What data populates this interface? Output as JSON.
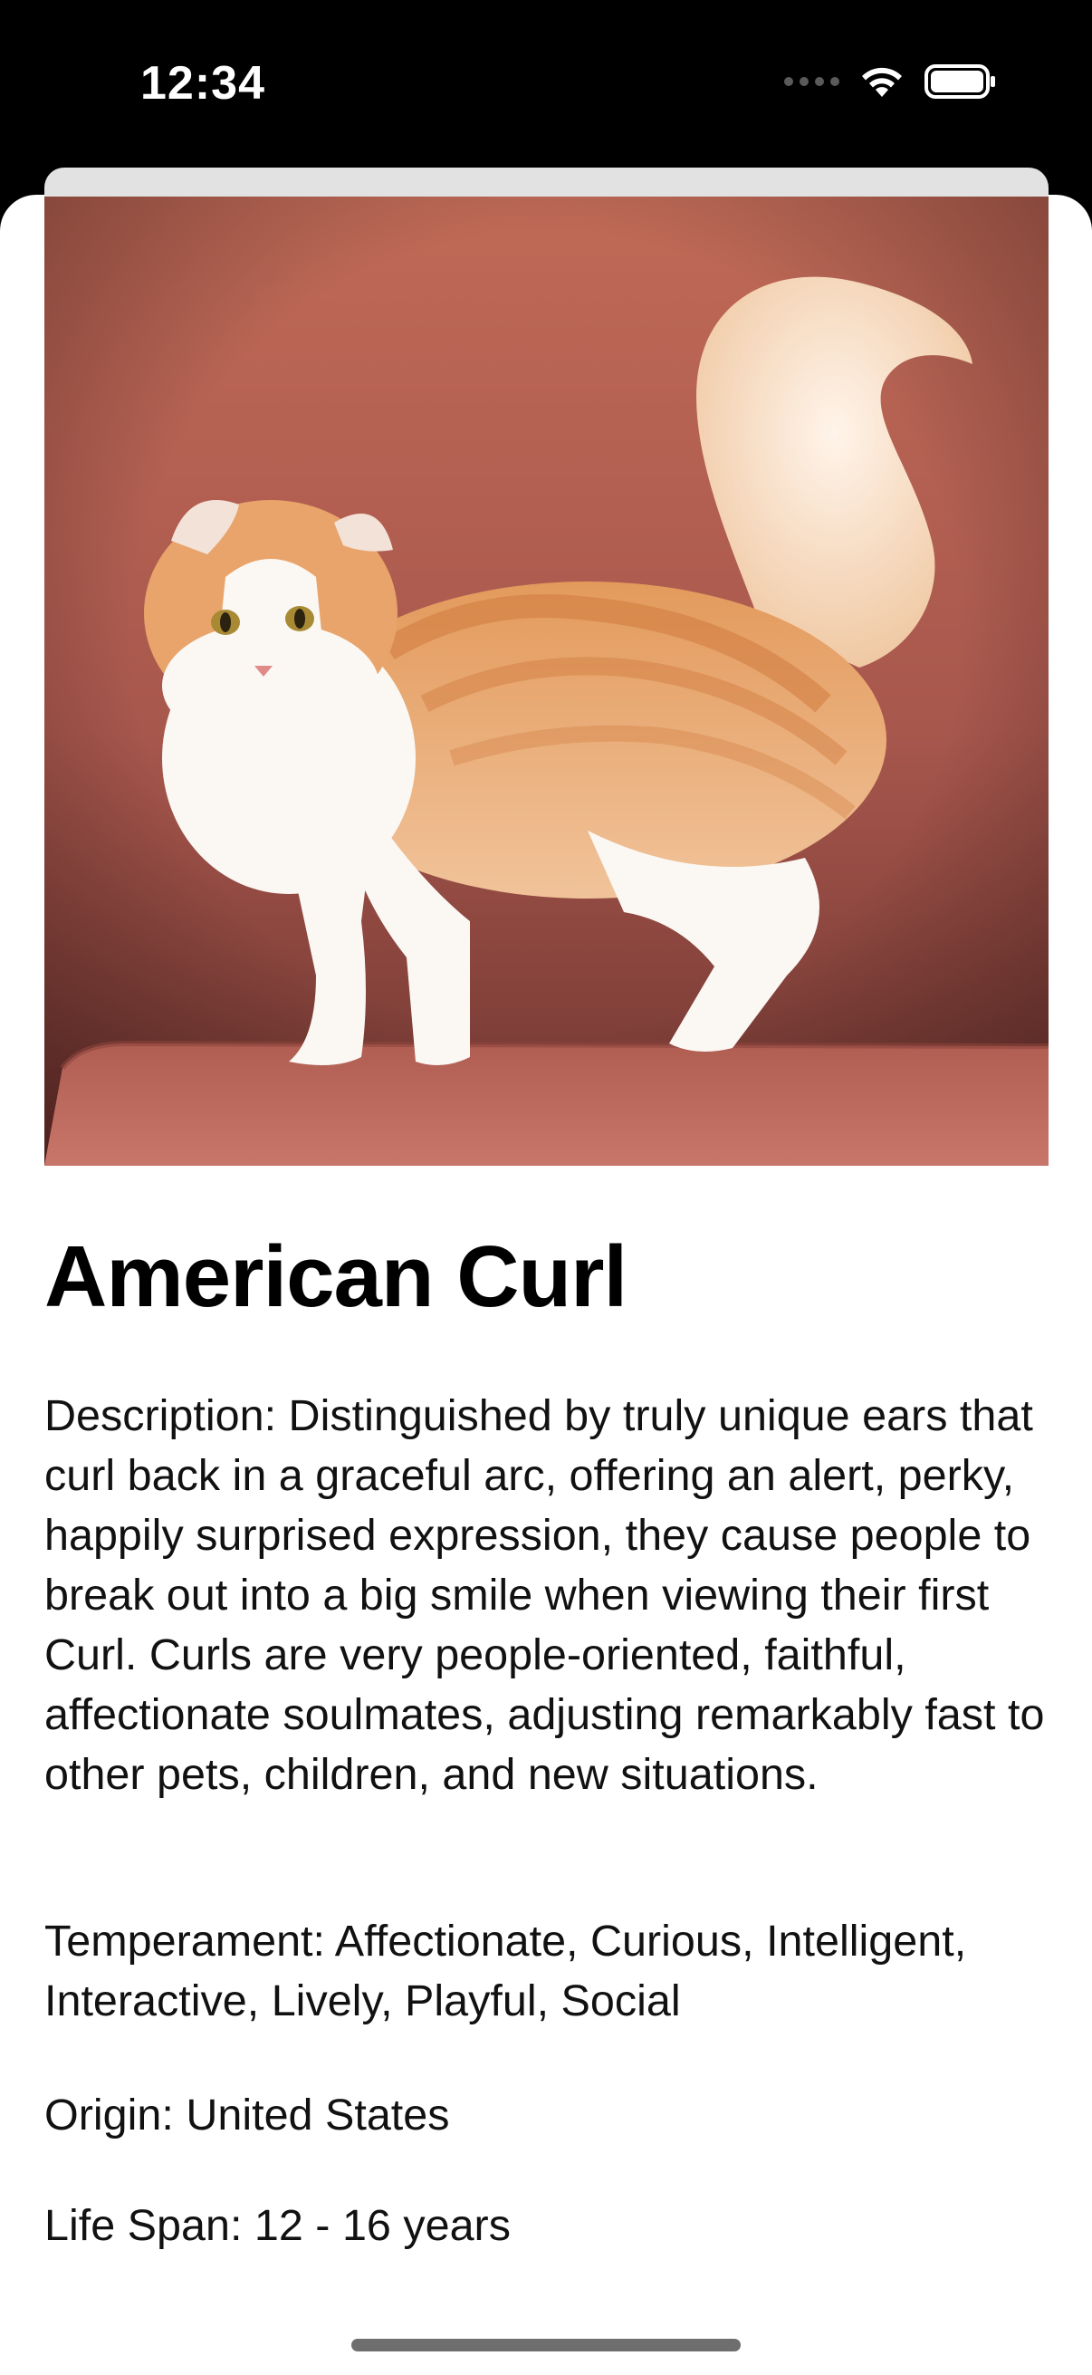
{
  "status_bar": {
    "time": "12:34"
  },
  "image": {
    "alt": "American Curl cat photo",
    "background_color": "#b8675a",
    "floor_color": "#c2675c"
  },
  "breed": {
    "name": "American Curl",
    "description": "Description: Distinguished by truly unique ears that curl back in a graceful arc, offering an alert, perky, happily surprised expression, they cause people to break out into a big smile when viewing their first Curl. Curls are very people-oriented, faithful, affectionate soulmates, adjusting remarkably fast to other pets, children, and new situations.",
    "temperament": "Temperament: Affectionate, Curious, Intelligent, Interactive, Lively, Playful, Social",
    "origin": "Origin: United States",
    "life_span": "Life Span: 12 - 16 years"
  },
  "icons": {
    "signal": "cellular-signal-icon",
    "wifi": "wifi-icon",
    "battery": "battery-icon"
  }
}
